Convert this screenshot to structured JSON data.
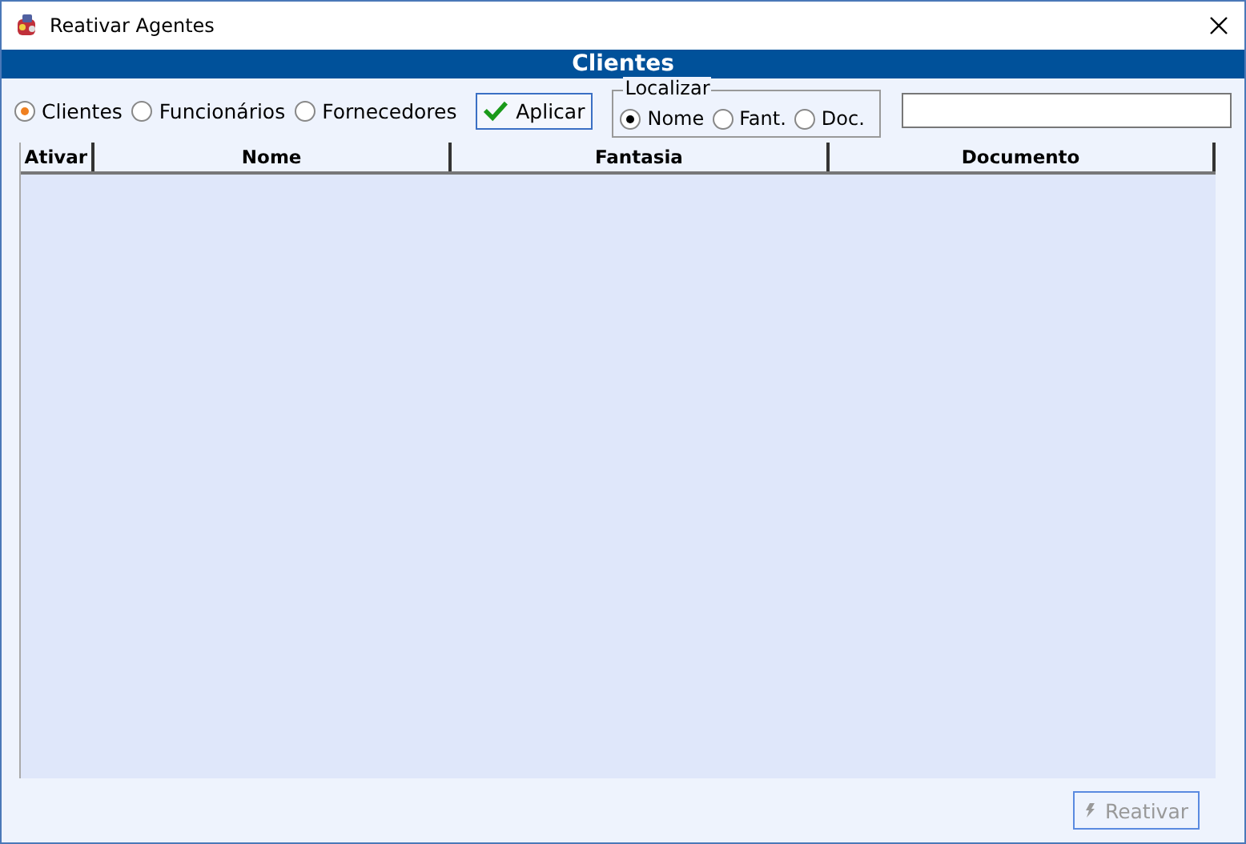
{
  "window": {
    "title": "Reativar Agentes"
  },
  "header": {
    "title": "Clientes"
  },
  "agent_types": [
    {
      "label": "Clientes",
      "selected": true
    },
    {
      "label": "Funcionários",
      "selected": false
    },
    {
      "label": "Fornecedores",
      "selected": false
    }
  ],
  "apply_button": {
    "label": "Aplicar"
  },
  "search_group": {
    "title": "Localizar",
    "options": [
      {
        "label": "Nome",
        "selected": true
      },
      {
        "label": "Fant.",
        "selected": false
      },
      {
        "label": "Doc.",
        "selected": false
      }
    ]
  },
  "table": {
    "columns": [
      "Ativar",
      "Nome",
      "Fantasia",
      "Documento"
    ]
  },
  "reactivate_button": {
    "label": "Reativar",
    "disabled": true
  }
}
